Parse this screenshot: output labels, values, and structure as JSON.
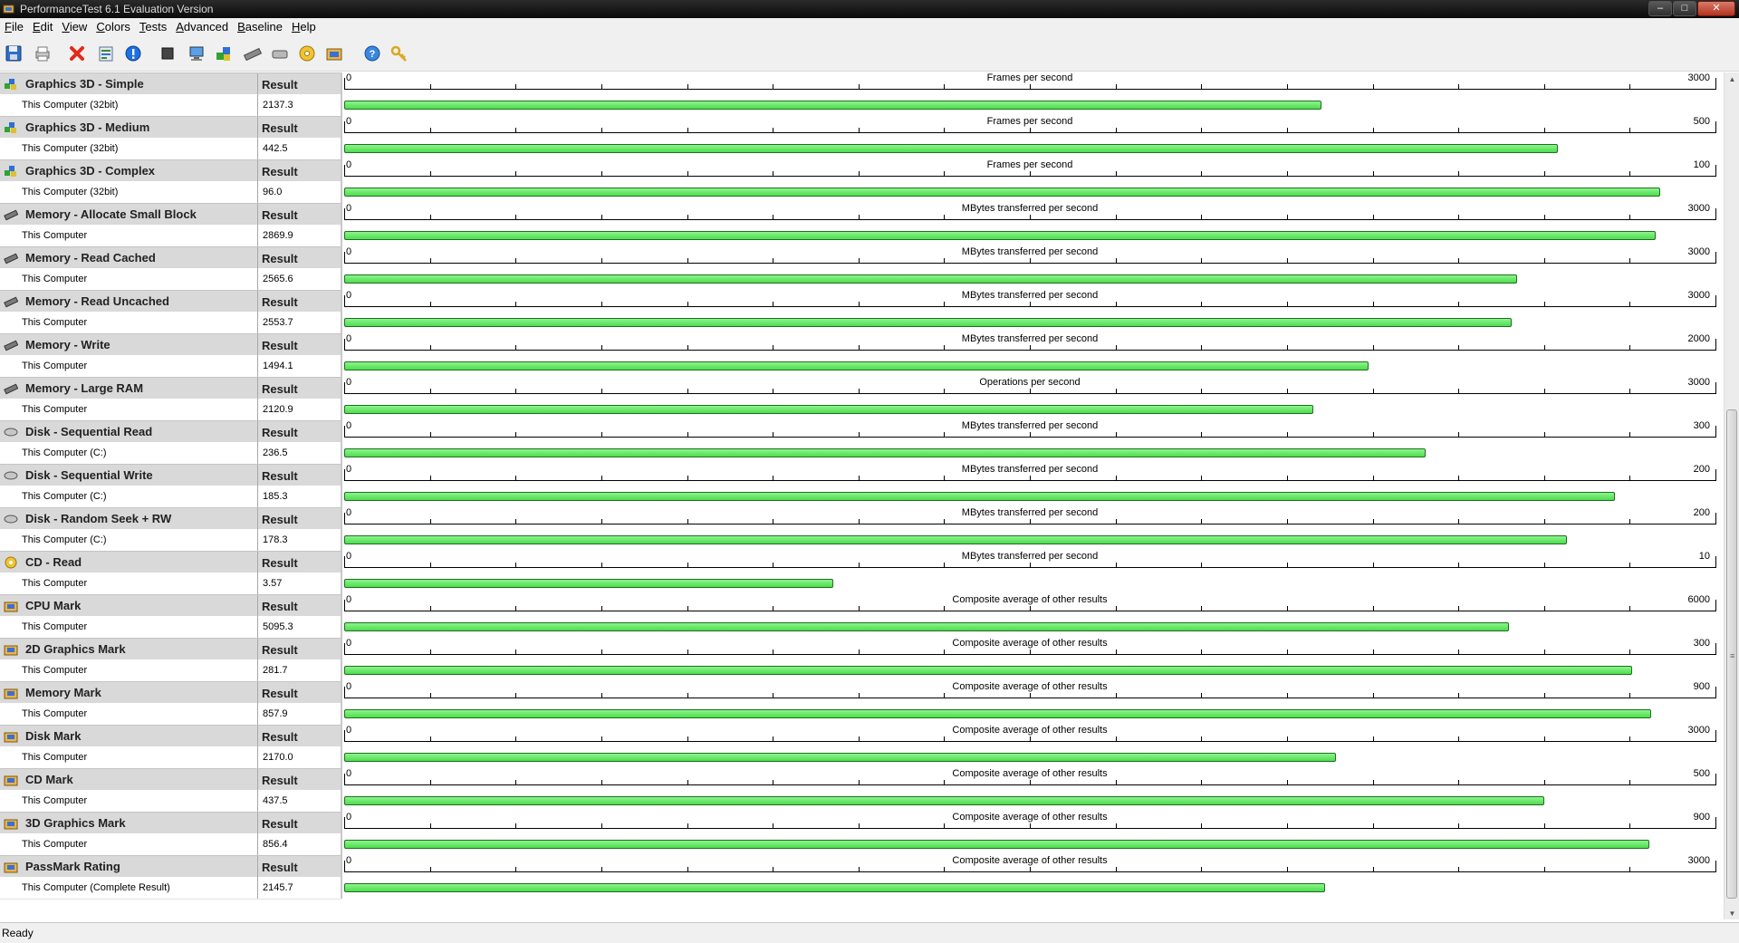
{
  "window": {
    "title": "PerformanceTest 6.1 Evaluation Version",
    "minimize_glyph": "–",
    "maximize_glyph": "□",
    "close_glyph": "✕"
  },
  "menu": [
    {
      "label": "File",
      "accel": "F",
      "rest": "ile"
    },
    {
      "label": "Edit",
      "accel": "E",
      "rest": "dit"
    },
    {
      "label": "View",
      "accel": "V",
      "rest": "iew"
    },
    {
      "label": "Colors",
      "accel": "C",
      "rest": "olors"
    },
    {
      "label": "Tests",
      "accel": "T",
      "rest": "ests"
    },
    {
      "label": "Advanced",
      "accel": "A",
      "rest": "dvanced"
    },
    {
      "label": "Baseline",
      "accel": "B",
      "rest": "aseline"
    },
    {
      "label": "Help",
      "accel": "H",
      "rest": "elp"
    }
  ],
  "toolbar": [
    {
      "name": "save-icon"
    },
    {
      "name": "print-icon"
    },
    {
      "name": "delete-icon"
    },
    {
      "name": "export-icon"
    },
    {
      "name": "info-icon"
    },
    {
      "name": "stop-icon"
    },
    {
      "name": "computer-icon"
    },
    {
      "name": "graphics-test-icon"
    },
    {
      "name": "memory-test-icon"
    },
    {
      "name": "disk-test-icon"
    },
    {
      "name": "cd-test-icon"
    },
    {
      "name": "run-all-icon"
    },
    {
      "name": "help-icon"
    },
    {
      "name": "key-icon"
    }
  ],
  "columns": {
    "result_header": "Result"
  },
  "colors": {
    "bar_fill": "#4fdc4f",
    "bar_border": "#1e6e1e",
    "header_row": "#d9d9d9"
  },
  "tests": [
    {
      "name": "Graphics 3D - Simple",
      "icon": "graphics-3d-icon",
      "computer": "This Computer (32bit)",
      "value": "2137.3",
      "unit": "Frames per second",
      "scale_min": "0",
      "scale_max": "3000"
    },
    {
      "name": "Graphics 3D - Medium",
      "icon": "graphics-3d-icon",
      "computer": "This Computer (32bit)",
      "value": "442.5",
      "unit": "Frames per second",
      "scale_min": "0",
      "scale_max": "500"
    },
    {
      "name": "Graphics 3D - Complex",
      "icon": "graphics-3d-icon",
      "computer": "This Computer (32bit)",
      "value": "96.0",
      "unit": "Frames per second",
      "scale_min": "0",
      "scale_max": "100"
    },
    {
      "name": "Memory - Allocate Small Block",
      "icon": "memory-icon",
      "computer": "This Computer",
      "value": "2869.9",
      "unit": "MBytes transferred per second",
      "scale_min": "0",
      "scale_max": "3000"
    },
    {
      "name": "Memory - Read Cached",
      "icon": "memory-icon",
      "computer": "This Computer",
      "value": "2565.6",
      "unit": "MBytes transferred per second",
      "scale_min": "0",
      "scale_max": "3000"
    },
    {
      "name": "Memory - Read Uncached",
      "icon": "memory-icon",
      "computer": "This Computer",
      "value": "2553.7",
      "unit": "MBytes transferred per second",
      "scale_min": "0",
      "scale_max": "3000"
    },
    {
      "name": "Memory - Write",
      "icon": "memory-icon",
      "computer": "This Computer",
      "value": "1494.1",
      "unit": "MBytes transferred per second",
      "scale_min": "0",
      "scale_max": "2000"
    },
    {
      "name": "Memory - Large RAM",
      "icon": "memory-icon",
      "computer": "This Computer",
      "value": "2120.9",
      "unit": "Operations per second",
      "scale_min": "0",
      "scale_max": "3000"
    },
    {
      "name": "Disk - Sequential Read",
      "icon": "disk-icon",
      "computer": "This Computer (C:)",
      "value": "236.5",
      "unit": "MBytes transferred per second",
      "scale_min": "0",
      "scale_max": "300"
    },
    {
      "name": "Disk - Sequential Write",
      "icon": "disk-icon",
      "computer": "This Computer (C:)",
      "value": "185.3",
      "unit": "MBytes transferred per second",
      "scale_min": "0",
      "scale_max": "200"
    },
    {
      "name": "Disk - Random Seek + RW",
      "icon": "disk-icon",
      "computer": "This Computer (C:)",
      "value": "178.3",
      "unit": "MBytes transferred per second",
      "scale_min": "0",
      "scale_max": "200"
    },
    {
      "name": "CD - Read",
      "icon": "cd-icon",
      "computer": "This Computer",
      "value": "3.57",
      "unit": "MBytes transferred per second",
      "scale_min": "0",
      "scale_max": "10"
    },
    {
      "name": "CPU Mark",
      "icon": "mark-icon",
      "computer": "This Computer",
      "value": "5095.3",
      "unit": "Composite average of other results",
      "scale_min": "0",
      "scale_max": "6000"
    },
    {
      "name": "2D Graphics Mark",
      "icon": "mark-icon",
      "computer": "This Computer",
      "value": "281.7",
      "unit": "Composite average of other results",
      "scale_min": "0",
      "scale_max": "300"
    },
    {
      "name": "Memory Mark",
      "icon": "mark-icon",
      "computer": "This Computer",
      "value": "857.9",
      "unit": "Composite average of other results",
      "scale_min": "0",
      "scale_max": "900"
    },
    {
      "name": "Disk Mark",
      "icon": "mark-icon",
      "computer": "This Computer",
      "value": "2170.0",
      "unit": "Composite average of other results",
      "scale_min": "0",
      "scale_max": "3000"
    },
    {
      "name": "CD Mark",
      "icon": "mark-icon",
      "computer": "This Computer",
      "value": "437.5",
      "unit": "Composite average of other results",
      "scale_min": "0",
      "scale_max": "500"
    },
    {
      "name": "3D Graphics Mark",
      "icon": "mark-icon",
      "computer": "This Computer",
      "value": "856.4",
      "unit": "Composite average of other results",
      "scale_min": "0",
      "scale_max": "900"
    },
    {
      "name": "PassMark Rating",
      "icon": "mark-icon",
      "computer": "This Computer (Complete Result)",
      "value": "2145.7",
      "unit": "Composite average of other results",
      "scale_min": "0",
      "scale_max": "3000"
    }
  ],
  "scrollbar": {
    "up_glyph": "▲",
    "down_glyph": "▼",
    "grip_glyph": "≡"
  },
  "status": {
    "text": "Ready"
  }
}
